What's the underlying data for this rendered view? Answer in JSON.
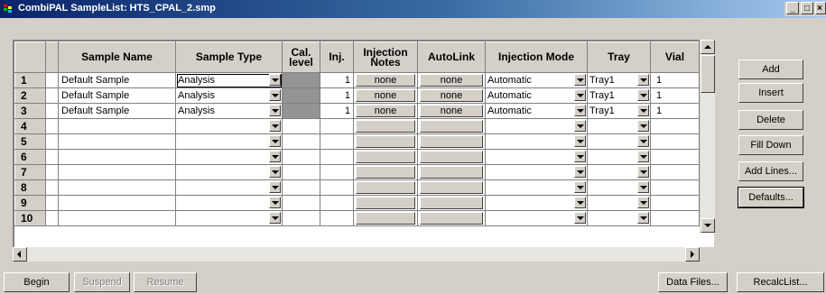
{
  "window": {
    "title": "CombiPAL SampleList: HTS_CPAL_2.smp",
    "minimize": "_",
    "maximize": "□",
    "close": "×"
  },
  "grid": {
    "columns": [
      "Sample Name",
      "Sample Type",
      "Cal. level",
      "Inj.",
      "Injection Notes",
      "AutoLink",
      "Injection Mode",
      "Tray",
      "Vial"
    ],
    "row_numbers": [
      "1",
      "2",
      "3",
      "4",
      "5",
      "6",
      "7",
      "8",
      "9",
      "10"
    ],
    "rows": [
      {
        "sample_name": "Default Sample",
        "sample_type": "Analysis",
        "inj": "1",
        "notes": "none",
        "autolink": "none",
        "mode": "Automatic",
        "tray": "Tray1",
        "vial": "1"
      },
      {
        "sample_name": "Default Sample",
        "sample_type": "Analysis",
        "inj": "1",
        "notes": "none",
        "autolink": "none",
        "mode": "Automatic",
        "tray": "Tray1",
        "vial": "1"
      },
      {
        "sample_name": "Default Sample",
        "sample_type": "Analysis",
        "inj": "1",
        "notes": "none",
        "autolink": "none",
        "mode": "Automatic",
        "tray": "Tray1",
        "vial": "1"
      }
    ]
  },
  "side_buttons": [
    "Add",
    "Insert",
    "Delete",
    "Fill Down",
    "Add Lines...",
    "Defaults..."
  ],
  "bottom_buttons": {
    "begin": "Begin",
    "suspend": "Suspend",
    "resume": "Resume",
    "data_files": "Data Files...",
    "recalc": "RecalcList..."
  },
  "colors": {
    "titlebar": "#0a246a",
    "face": "#d4d0c8",
    "cal_cell": "#949494"
  }
}
